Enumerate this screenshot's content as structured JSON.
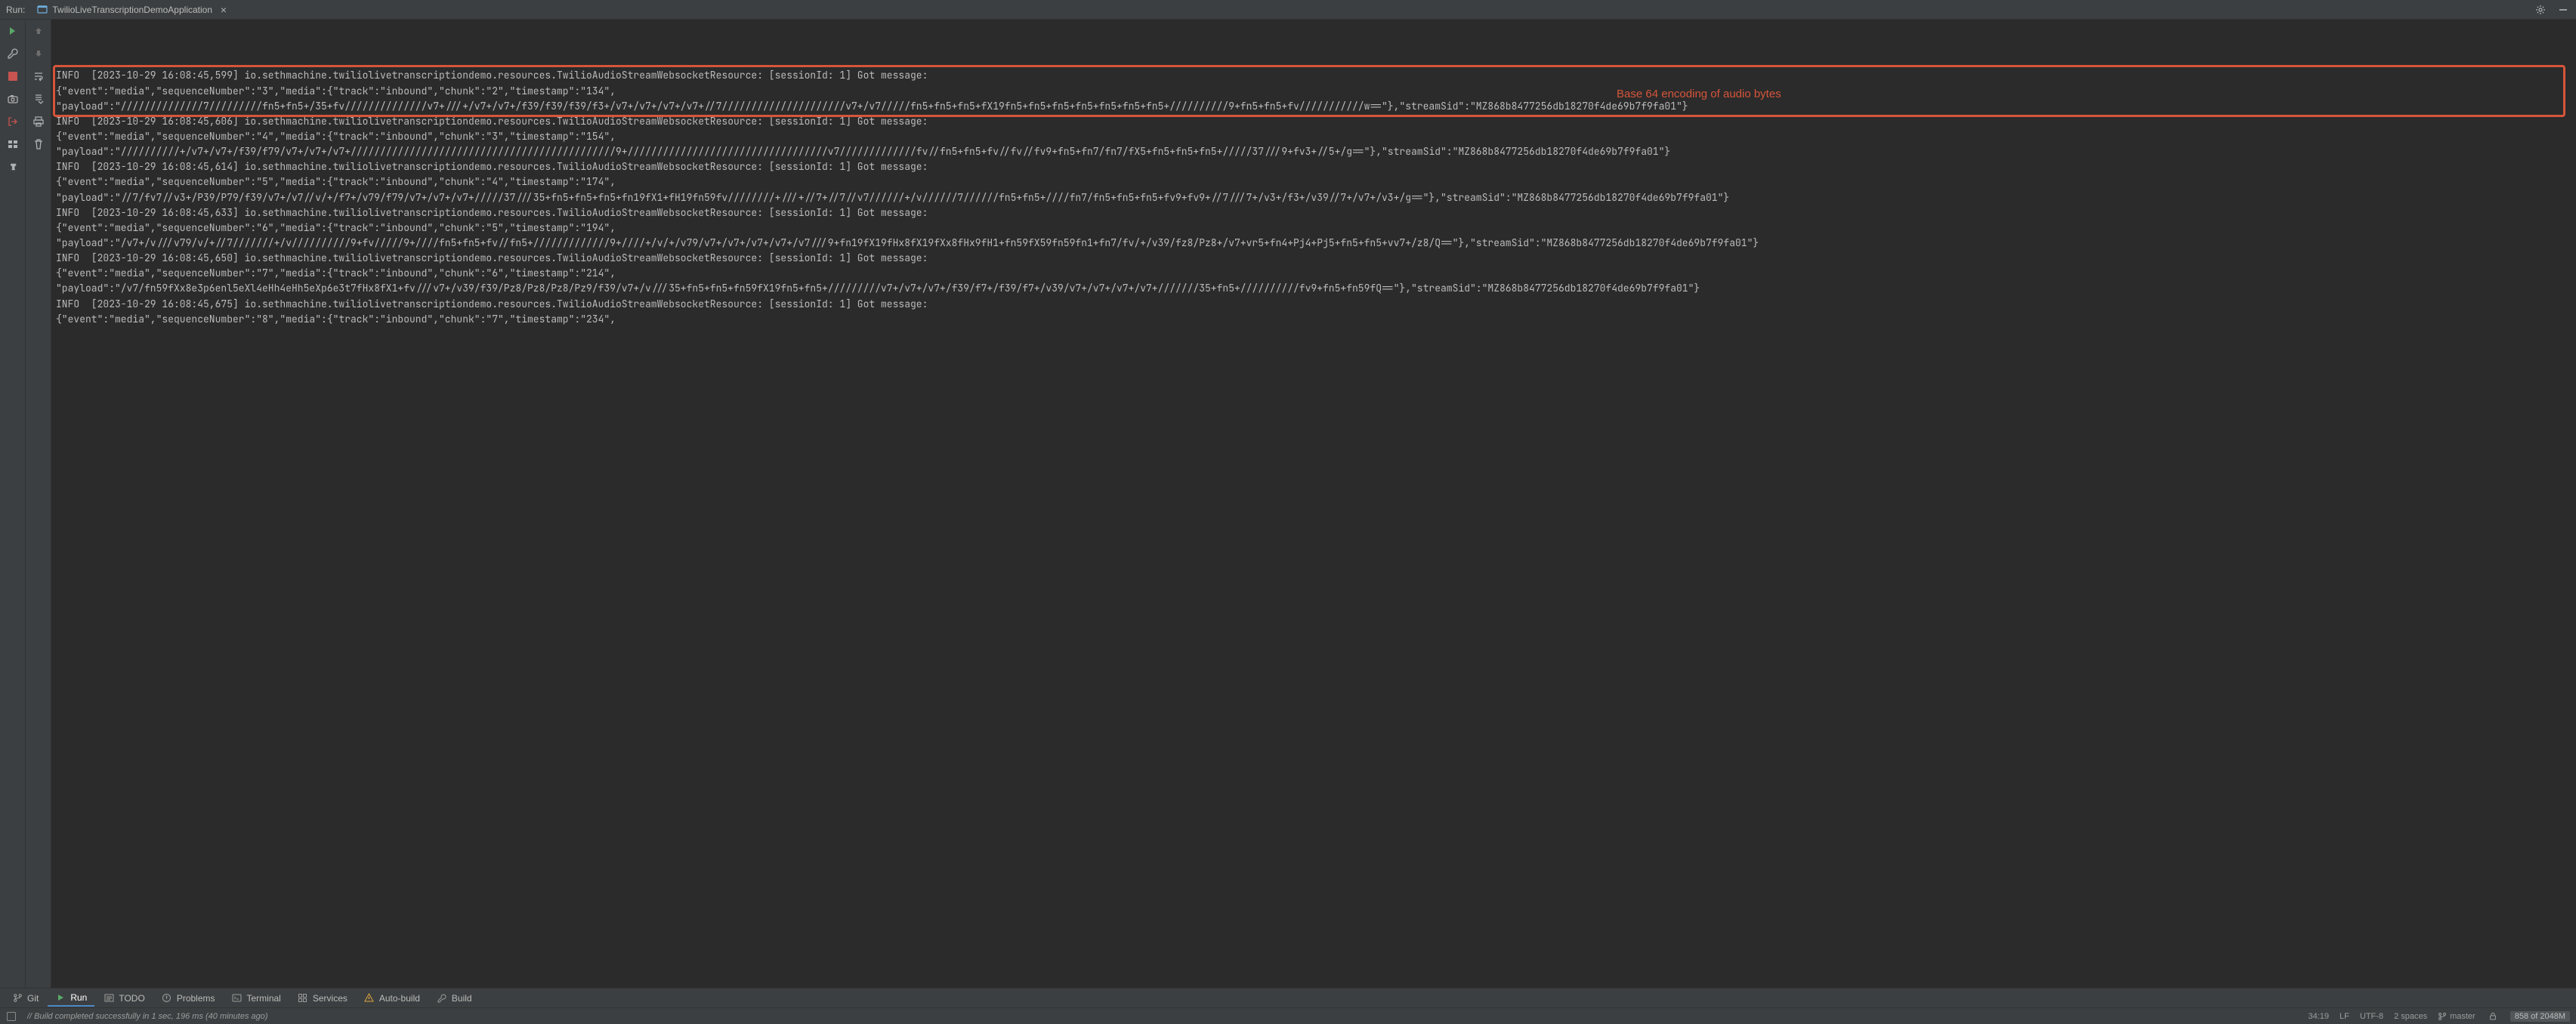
{
  "colors": {
    "highlight_border": "#d6553a",
    "annotation_text": "#d6553a",
    "rerun_green": "#59a869",
    "stop_red": "#c75450",
    "accent_blue": "#4a88c7"
  },
  "top_bar": {
    "run_label": "Run:",
    "tab_title": "TwilioLiveTranscriptionDemoApplication",
    "tab_close": "×",
    "right_icons": [
      "gear-icon",
      "minimize-icon"
    ]
  },
  "left_gutter": {
    "icons": [
      "rerun-icon",
      "wrench-icon",
      "stop-icon",
      "camera-icon",
      "exit-icon",
      "layout-icon",
      "pin-icon"
    ]
  },
  "mid_gutter": {
    "icons": [
      "arrow-up-icon",
      "arrow-down-icon",
      "soft-wrap-icon",
      "scroll-to-end-icon",
      "print-icon",
      "trash-icon"
    ]
  },
  "console_lines": [
    "INFO  [2023-10-29 16:08:45,599] io.sethmachine.twiliolivetranscriptiondemo.resources.TwilioAudioStreamWebsocketResource: [sessionId: 1] Got message: ",
    "{\"event\":\"media\",\"sequenceNumber\":\"3\",\"media\":{\"track\":\"inbound\",\"chunk\":\"2\",\"timestamp\":\"134\",",
    "\"payload\":\"//////////////7/////////fn5+fn5+/35+fv//////////////v7+///+/v7+/v7+/f39/f39/f39/f3+/v7+/v7+/v7+/v7+//7/////////////////////v7+/v7/////fn5+fn5+fn5+fX19fn5+fn5+fn5+fn5+fn5+fn5+fn5+//////////9+fn5+fn5+fv///////////w==\"},\"streamSid\":\"MZ868b8477256db18270f4de69b7f9fa01\"}",
    "INFO  [2023-10-29 16:08:45,606] io.sethmachine.twiliolivetranscriptiondemo.resources.TwilioAudioStreamWebsocketResource: [sessionId: 1] Got message: ",
    "{\"event\":\"media\",\"sequenceNumber\":\"4\",\"media\":{\"track\":\"inbound\",\"chunk\":\"3\",\"timestamp\":\"154\",",
    "\"payload\":\"//////////+/v7+/v7+/f39/f79/v7+/v7+/v7+/////////////////////////////////////////////9+//////////////////////////////////v7/////////////fv//fn5+fn5+fv//fv//fv9+fn5+fn7/fn7/fX5+fn5+fn5+fn5+/////37///9+fv3+//5+/g==\"},\"streamSid\":\"MZ868b8477256db18270f4de69b7f9fa01\"}",
    "INFO  [2023-10-29 16:08:45,614] io.sethmachine.twiliolivetranscriptiondemo.resources.TwilioAudioStreamWebsocketResource: [sessionId: 1] Got message: ",
    "{\"event\":\"media\",\"sequenceNumber\":\"5\",\"media\":{\"track\":\"inbound\",\"chunk\":\"4\",\"timestamp\":\"174\",",
    "\"payload\":\"//7/fv7//v3+/P39/P79/f39/v7+/v7//v/+/f7+/v79/f79/v7+/v7+/v7+/////37///35+fn5+fn5+fn5+fn19fX1+fH19fn59fv////////+///+//7+//7//v7//////+/v//////7//////fn5+fn5+////fn7/fn5+fn5+fn5+fv9+fv9+//7///7+/v3+/f3+/v39//7+/v7+/v3+/g==\"},\"streamSid\":\"MZ868b8477256db18270f4de69b7f9fa01\"}",
    "INFO  [2023-10-29 16:08:45,633] io.sethmachine.twiliolivetranscriptiondemo.resources.TwilioAudioStreamWebsocketResource: [sessionId: 1] Got message: ",
    "{\"event\":\"media\",\"sequenceNumber\":\"6\",\"media\":{\"track\":\"inbound\",\"chunk\":\"5\",\"timestamp\":\"194\",",
    "\"payload\":\"/v7+/v///v79/v/+//7///////+/v//////////9+fv/////9+////fn5+fn5+fv//fn5+/////////////9+////+/v/+/v79/v7+/v7+/v7+/v7+/v7///9+fn19fX19fHx8fX19fXx8fHx9fH1+fn59fX59fn59fn1+fn7/fv/+/v39/fz8/Pz8+/v7+vr5+fn4+Pj4+Pj5+fn5+fn5+vv7+/z8/Q==\"},\"streamSid\":\"MZ868b8477256db18270f4de69b7f9fa01\"}",
    "INFO  [2023-10-29 16:08:45,650] io.sethmachine.twiliolivetranscriptiondemo.resources.TwilioAudioStreamWebsocketResource: [sessionId: 1] Got message: ",
    "{\"event\":\"media\",\"sequenceNumber\":\"7\",\"media\":{\"track\":\"inbound\",\"chunk\":\"6\",\"timestamp\":\"214\",",
    "\"payload\":\"/v7/fn59fXx8e3p6enl5eXl4eHh4eHh5eXp6e3t7fHx8fX1+fv///v7+/v39/f39/Pz8/Pz8/Pz8/Pz9/f39/v7+/v///35+fn5+fn5+fn59fX19fn5+fn5+/////////v7+/v7+/v7+/f39/f7+/f39/f7+/v39/v7+/v7+/v7+/v7+///////35+fn5+//////////fv9+fn5+fn59fQ==\"},\"streamSid\":\"MZ868b8477256db18270f4de69b7f9fa01\"}",
    "INFO  [2023-10-29 16:08:45,675] io.sethmachine.twiliolivetranscriptiondemo.resources.TwilioAudioStreamWebsocketResource: [sessionId: 1] Got message: ",
    "{\"event\":\"media\",\"sequenceNumber\":\"8\",\"media\":{\"track\":\"inbound\",\"chunk\":\"7\",\"timestamp\":\"234\","
  ],
  "annotation_text": "Base 64 encoding of audio bytes",
  "bottom_tabs": [
    {
      "icon": "git-branch-icon",
      "label": "Git",
      "active": false
    },
    {
      "icon": "play-icon",
      "label": "Run",
      "active": true
    },
    {
      "icon": "todo-icon",
      "label": "TODO",
      "active": false
    },
    {
      "icon": "problems-icon",
      "label": "Problems",
      "active": false
    },
    {
      "icon": "terminal-icon",
      "label": "Terminal",
      "active": false
    },
    {
      "icon": "services-icon",
      "label": "Services",
      "active": false
    },
    {
      "icon": "auto-build-icon",
      "label": "Auto-build",
      "active": false
    },
    {
      "icon": "build-icon",
      "label": "Build",
      "active": false
    }
  ],
  "status_bar": {
    "indexing_icon": "checkbox-icon",
    "build_message": "// Build completed successfully in 1 sec, 196 ms (40 minutes ago)",
    "caret": "34:19",
    "line_sep": "LF",
    "encoding": "UTF-8",
    "indent": "2 spaces",
    "branch_icon": "git-branch-icon",
    "branch": "master",
    "lock_icon": "lock-icon",
    "memory": "858 of 2048M"
  }
}
